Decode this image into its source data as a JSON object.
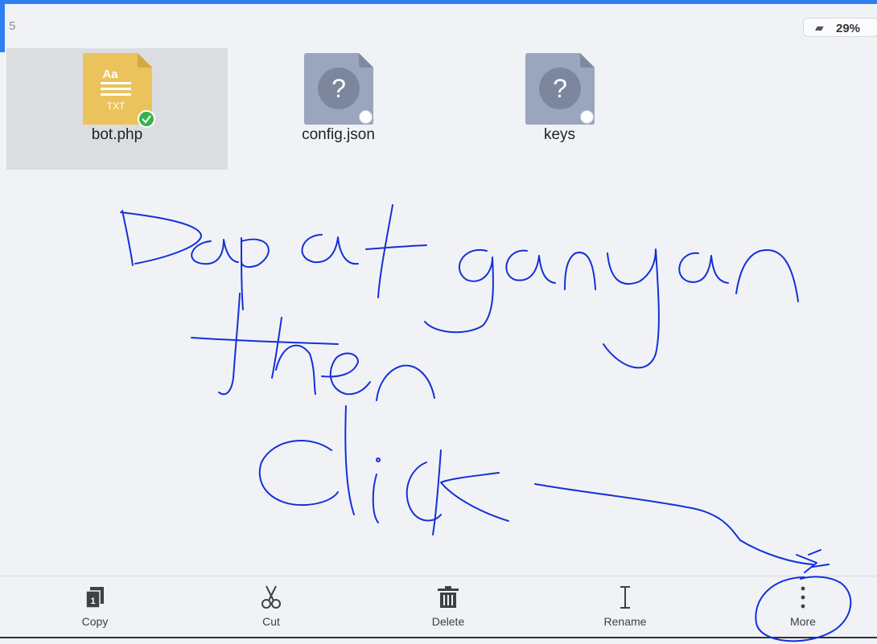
{
  "header": {
    "page_number": "5",
    "battery_percent": "29%"
  },
  "files": [
    {
      "name": "bot.php",
      "icon": "txt-file-icon",
      "icon_label_top": "Aa",
      "icon_label_bottom": "TXT",
      "selected": true
    },
    {
      "name": "config.json",
      "icon": "unknown-file-icon",
      "glyph": "?",
      "selected": false
    },
    {
      "name": "keys",
      "icon": "unknown-file-icon",
      "glyph": "?",
      "selected": false
    }
  ],
  "toolbar": {
    "copy_label": "Copy",
    "copy_badge": "1",
    "cut_label": "Cut",
    "delete_label": "Delete",
    "rename_label": "Rename",
    "more_label": "More"
  },
  "colors": {
    "accent": "#2f7ff0",
    "ink": "#1430d8",
    "txt_icon": "#eac35c",
    "unknown_icon": "#9aa6bd"
  }
}
